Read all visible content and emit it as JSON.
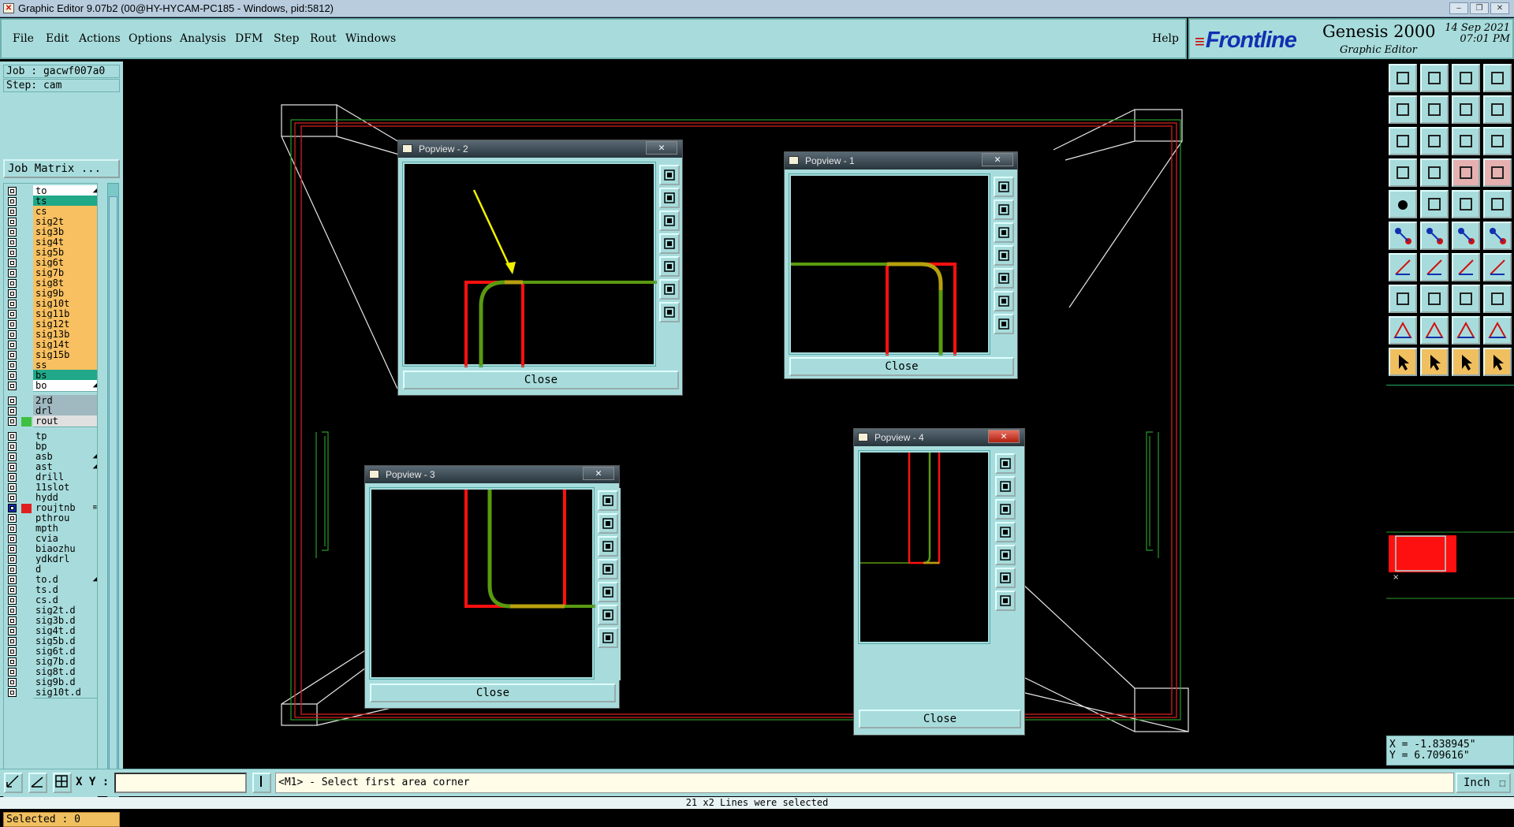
{
  "window": {
    "title": "Graphic Editor 9.07b2 (00@HY-HYCAM-PC185 - Windows, pid:5812)",
    "controls": [
      "–",
      "❐",
      "✕"
    ]
  },
  "menu": {
    "items": [
      "File",
      "Edit",
      "Actions",
      "Options",
      "Analysis",
      "DFM",
      "Step",
      "Rout",
      "Windows"
    ],
    "help": "Help"
  },
  "brand": {
    "company": "Frontline",
    "product": "Genesis 2000",
    "subtitle": "Graphic Editor",
    "date": "14 Sep 2021",
    "time": "07:01 PM"
  },
  "job": {
    "job_line": "Job : gacwf007a0",
    "step_line": "Step: cam",
    "matrix_button": "Job Matrix ..."
  },
  "layers": [
    {
      "name": "to",
      "color": "#ffffff",
      "tag": "◢"
    },
    {
      "name": "ts",
      "color": "#20a888",
      "tag": ""
    },
    {
      "name": "cs",
      "color": "#f8c060",
      "tag": ""
    },
    {
      "name": "sig2t",
      "color": "#f8c060",
      "tag": ""
    },
    {
      "name": "sig3b",
      "color": "#f8c060",
      "tag": ""
    },
    {
      "name": "sig4t",
      "color": "#f8c060",
      "tag": ""
    },
    {
      "name": "sig5b",
      "color": "#f8c060",
      "tag": ""
    },
    {
      "name": "sig6t",
      "color": "#f8c060",
      "tag": ""
    },
    {
      "name": "sig7b",
      "color": "#f8c060",
      "tag": ""
    },
    {
      "name": "sig8t",
      "color": "#f8c060",
      "tag": ""
    },
    {
      "name": "sig9b",
      "color": "#f8c060",
      "tag": ""
    },
    {
      "name": "sig10t",
      "color": "#f8c060",
      "tag": ""
    },
    {
      "name": "sig11b",
      "color": "#f8c060",
      "tag": ""
    },
    {
      "name": "sig12t",
      "color": "#f8c060",
      "tag": ""
    },
    {
      "name": "sig13b",
      "color": "#f8c060",
      "tag": ""
    },
    {
      "name": "sig14t",
      "color": "#f8c060",
      "tag": ""
    },
    {
      "name": "sig15b",
      "color": "#f8c060",
      "tag": ""
    },
    {
      "name": "ss",
      "color": "#f8c060",
      "tag": ""
    },
    {
      "name": "bs",
      "color": "#20a888",
      "tag": ""
    },
    {
      "name": "bo",
      "color": "#ffffff",
      "tag": "◢"
    },
    {
      "name": "2rd",
      "color": "#a0b8c0",
      "tag": "",
      "gap": true
    },
    {
      "name": "drl",
      "color": "#a0b8c0",
      "tag": ""
    },
    {
      "name": "rout",
      "color": "#e0e0e0",
      "tag": "",
      "active": "#40c040"
    },
    {
      "name": "tp",
      "color": "#a8dcdc",
      "tag": "",
      "gap": true
    },
    {
      "name": "bp",
      "color": "#a8dcdc",
      "tag": ""
    },
    {
      "name": "asb",
      "color": "#a8dcdc",
      "tag": "◢"
    },
    {
      "name": "ast",
      "color": "#a8dcdc",
      "tag": "◢"
    },
    {
      "name": "drill",
      "color": "#a8dcdc",
      "tag": ""
    },
    {
      "name": "11slot",
      "color": "#a8dcdc",
      "tag": ""
    },
    {
      "name": "hydd",
      "color": "#a8dcdc",
      "tag": ""
    },
    {
      "name": "roujtnb",
      "color": "#a8dcdc",
      "tag": "≡",
      "active": "#e02020",
      "work": true
    },
    {
      "name": "pthrou",
      "color": "#a8dcdc",
      "tag": ""
    },
    {
      "name": "mpth",
      "color": "#a8dcdc",
      "tag": ""
    },
    {
      "name": "cvia",
      "color": "#a8dcdc",
      "tag": ""
    },
    {
      "name": "biaozhu",
      "color": "#a8dcdc",
      "tag": ""
    },
    {
      "name": "ydkdrl",
      "color": "#a8dcdc",
      "tag": ""
    },
    {
      "name": "d",
      "color": "#a8dcdc",
      "tag": ""
    },
    {
      "name": "to.d",
      "color": "#a8dcdc",
      "tag": "◢"
    },
    {
      "name": "ts.d",
      "color": "#a8dcdc",
      "tag": ""
    },
    {
      "name": "cs.d",
      "color": "#a8dcdc",
      "tag": ""
    },
    {
      "name": "sig2t.d",
      "color": "#a8dcdc",
      "tag": ""
    },
    {
      "name": "sig3b.d",
      "color": "#a8dcdc",
      "tag": ""
    },
    {
      "name": "sig4t.d",
      "color": "#a8dcdc",
      "tag": ""
    },
    {
      "name": "sig5b.d",
      "color": "#a8dcdc",
      "tag": ""
    },
    {
      "name": "sig6t.d",
      "color": "#a8dcdc",
      "tag": ""
    },
    {
      "name": "sig7b.d",
      "color": "#a8dcdc",
      "tag": ""
    },
    {
      "name": "sig8t.d",
      "color": "#a8dcdc",
      "tag": ""
    },
    {
      "name": "sig9b.d",
      "color": "#a8dcdc",
      "tag": ""
    },
    {
      "name": "sig10t.d",
      "color": "#a8dcdc",
      "tag": ""
    }
  ],
  "selected": "Selected : 0",
  "popviews": [
    {
      "title": "Popview - 2",
      "close": "Close"
    },
    {
      "title": "Popview - 1",
      "close": "Close"
    },
    {
      "title": "Popview - 3",
      "close": "Close"
    },
    {
      "title": "Popview - 4",
      "close": "Close"
    }
  ],
  "coords": {
    "x": "X = -1.838945\"",
    "y": "Y = 6.709616\""
  },
  "bottom": {
    "xy_label": "X Y :",
    "xy_value": "",
    "prompt": "<M1> - Select first area corner",
    "unit": "Inch"
  },
  "status": "21 x2 Lines were selected"
}
